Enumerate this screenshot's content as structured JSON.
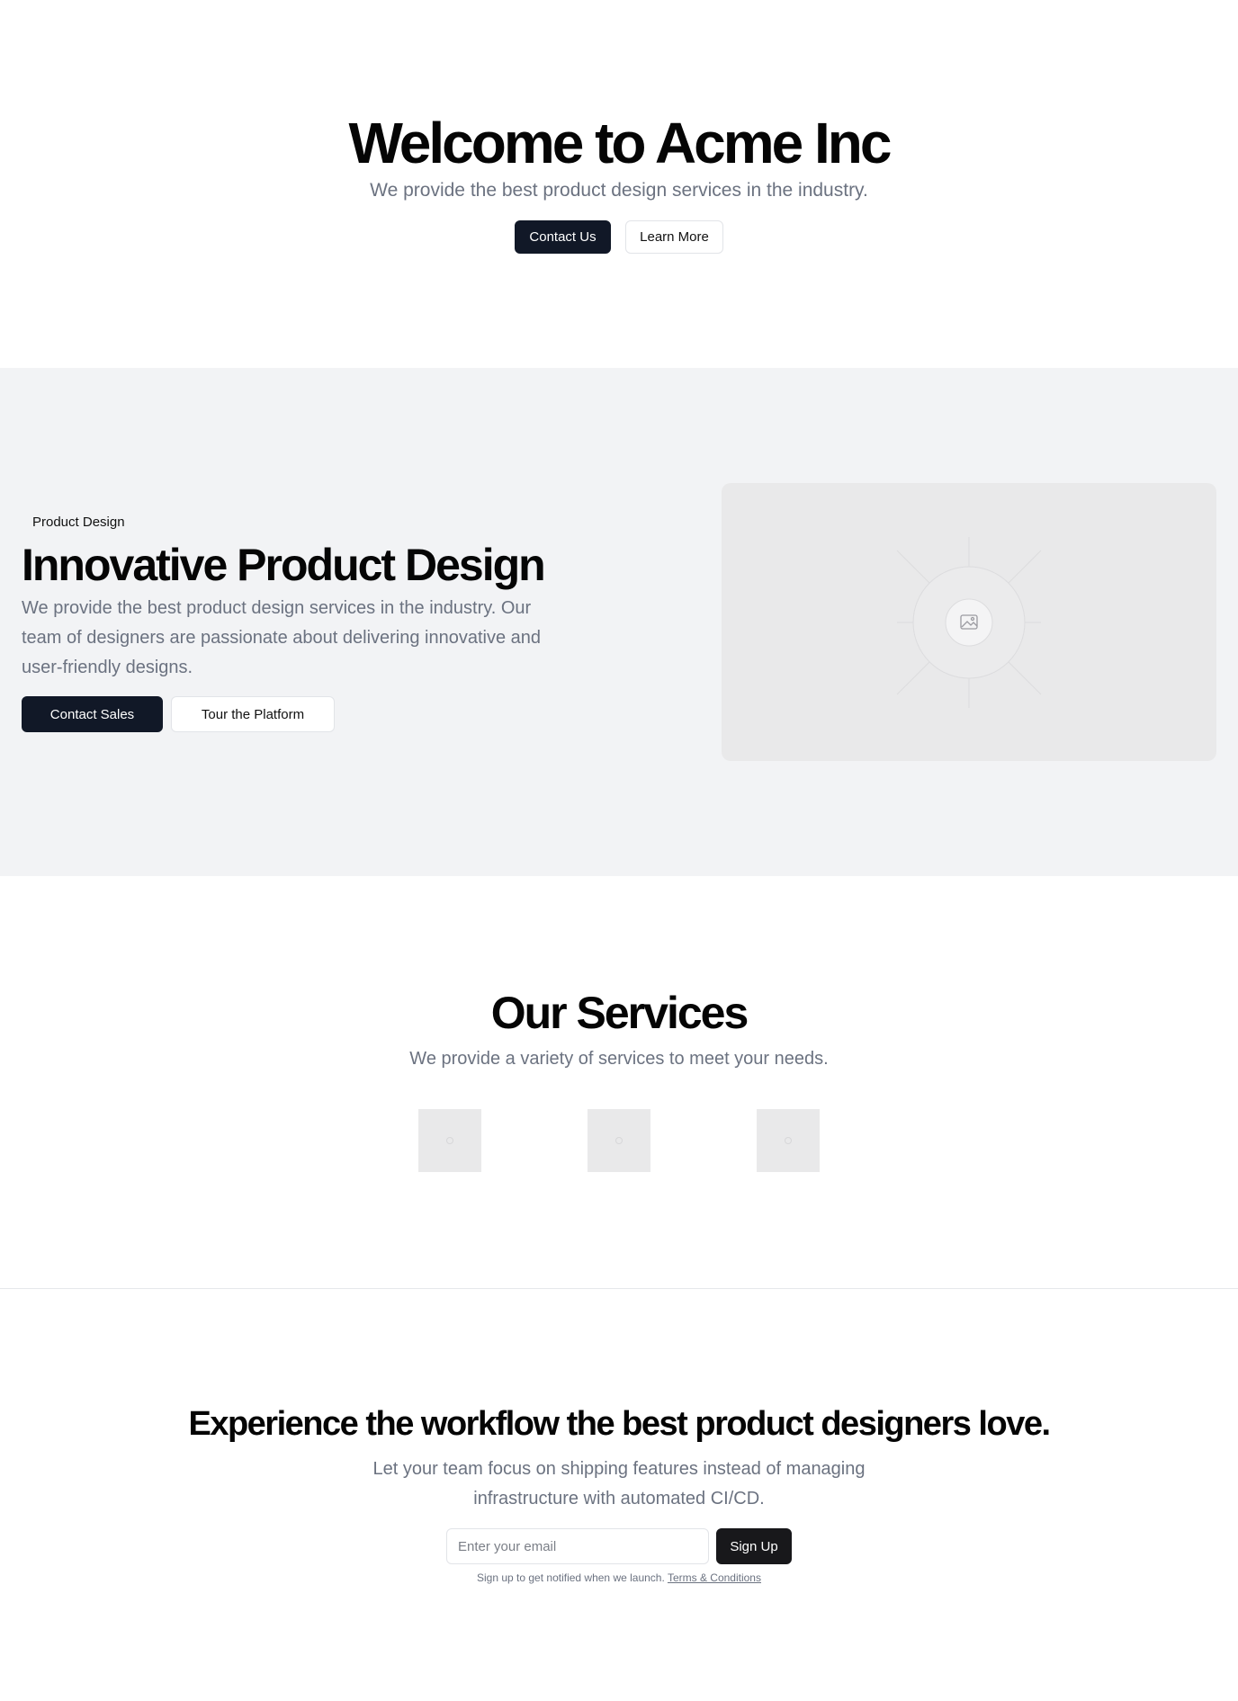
{
  "hero": {
    "title": "Welcome to Acme Inc",
    "subtitle": "We provide the best product design services in the industry.",
    "primary_button": "Contact Us",
    "secondary_button": "Learn More"
  },
  "feature": {
    "badge": "Product Design",
    "title": "Innovative Product Design",
    "text": "We provide the best product design services in the industry. Our team of designers are passionate about delivering innovative and user-friendly designs.",
    "primary_button": "Contact Sales",
    "secondary_button": "Tour the Platform",
    "image_icon": "image-icon"
  },
  "services": {
    "title": "Our Services",
    "subtitle": "We provide a variety of services to meet your needs.",
    "thumb_icon": "image-placeholder-icon"
  },
  "cta": {
    "title": "Experience the workflow the best product designers love.",
    "subtitle": "Let your team focus on shipping features instead of managing infrastructure with automated CI/CD.",
    "email_placeholder": "Enter your email",
    "button": "Sign Up",
    "note": "Sign up to get notified when we launch.",
    "terms_link": "Terms & Conditions"
  },
  "colors": {
    "primary_dark": "#111827",
    "muted_text": "#6b7280",
    "section_bg": "#f2f3f5",
    "placeholder_bg": "#e9e9ea"
  }
}
